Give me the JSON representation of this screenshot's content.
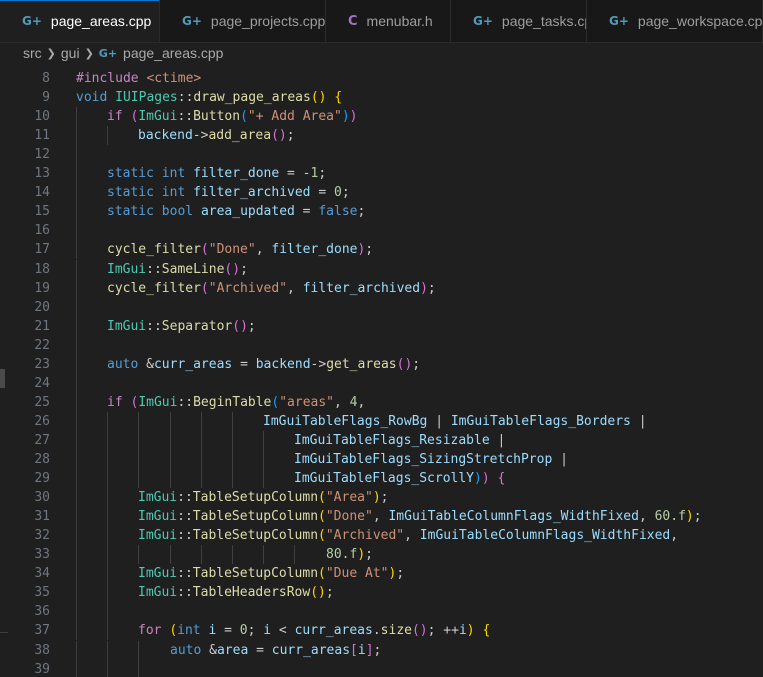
{
  "tabs": [
    {
      "label": "page_areas.cpp",
      "icon": "cpp-file-icon",
      "active": true
    },
    {
      "label": "page_projects.cpp",
      "icon": "cpp-file-icon",
      "active": false
    },
    {
      "label": "menubar.h",
      "icon": "c-header-file-icon",
      "active": false
    },
    {
      "label": "page_tasks.cpp",
      "icon": "cpp-file-icon",
      "active": false
    },
    {
      "label": "page_workspace.cpp",
      "icon": "cpp-file-icon",
      "active": false
    }
  ],
  "breadcrumb": [
    "src",
    "gui",
    "page_areas.cpp"
  ],
  "lines": [
    {
      "n": "8",
      "indent": 0,
      "t": [
        [
          "ctl",
          "#include "
        ],
        [
          "str",
          "<ctime>"
        ]
      ]
    },
    {
      "n": "9",
      "indent": 0,
      "t": [
        [
          "kw",
          "void "
        ],
        [
          "ns",
          "IUIPages"
        ],
        [
          "",
          "::"
        ],
        [
          "fn",
          "draw_page_areas"
        ],
        [
          "p1",
          "()"
        ],
        [
          "",
          " "
        ],
        [
          "p1",
          "{"
        ]
      ]
    },
    {
      "n": "10",
      "indent": 1,
      "t": [
        [
          "ctl",
          "if "
        ],
        [
          "p2",
          "("
        ],
        [
          "ns",
          "ImGui"
        ],
        [
          "",
          "::"
        ],
        [
          "fn",
          "Button"
        ],
        [
          "p3",
          "("
        ],
        [
          "str",
          "\"+ Add Area\""
        ],
        [
          "p3",
          ")"
        ],
        [
          "p2",
          ")"
        ]
      ]
    },
    {
      "n": "11",
      "indent": 2,
      "t": [
        [
          "var",
          "backend"
        ],
        [
          "",
          "->"
        ],
        [
          "fn",
          "add_area"
        ],
        [
          "p2",
          "()"
        ],
        [
          "",
          ";"
        ]
      ]
    },
    {
      "n": "12",
      "indent": 1,
      "t": []
    },
    {
      "n": "13",
      "indent": 1,
      "t": [
        [
          "kw",
          "static "
        ],
        [
          "kw",
          "int "
        ],
        [
          "var",
          "filter_done"
        ],
        [
          "",
          " = -"
        ],
        [
          "num",
          "1"
        ],
        [
          "",
          ";"
        ]
      ]
    },
    {
      "n": "14",
      "indent": 1,
      "t": [
        [
          "kw",
          "static "
        ],
        [
          "kw",
          "int "
        ],
        [
          "var",
          "filter_archived"
        ],
        [
          "",
          " = "
        ],
        [
          "num",
          "0"
        ],
        [
          "",
          ";"
        ]
      ]
    },
    {
      "n": "15",
      "indent": 1,
      "t": [
        [
          "kw",
          "static "
        ],
        [
          "kw",
          "bool "
        ],
        [
          "var",
          "area_updated"
        ],
        [
          "",
          " = "
        ],
        [
          "kw",
          "false"
        ],
        [
          "",
          ";"
        ]
      ]
    },
    {
      "n": "16",
      "indent": 1,
      "t": []
    },
    {
      "n": "17",
      "indent": 1,
      "t": [
        [
          "fn",
          "cycle_filter"
        ],
        [
          "p2",
          "("
        ],
        [
          "str",
          "\"Done\""
        ],
        [
          "",
          ", "
        ],
        [
          "var",
          "filter_done"
        ],
        [
          "p2",
          ")"
        ],
        [
          "",
          ";"
        ]
      ]
    },
    {
      "n": "18",
      "indent": 1,
      "t": [
        [
          "ns",
          "ImGui"
        ],
        [
          "",
          "::"
        ],
        [
          "fn",
          "SameLine"
        ],
        [
          "p2",
          "()"
        ],
        [
          "",
          ";"
        ]
      ]
    },
    {
      "n": "19",
      "indent": 1,
      "t": [
        [
          "fn",
          "cycle_filter"
        ],
        [
          "p2",
          "("
        ],
        [
          "str",
          "\"Archived\""
        ],
        [
          "",
          ", "
        ],
        [
          "var",
          "filter_archived"
        ],
        [
          "p2",
          ")"
        ],
        [
          "",
          ";"
        ]
      ]
    },
    {
      "n": "20",
      "indent": 1,
      "t": []
    },
    {
      "n": "21",
      "indent": 1,
      "t": [
        [
          "ns",
          "ImGui"
        ],
        [
          "",
          "::"
        ],
        [
          "fn",
          "Separator"
        ],
        [
          "p2",
          "()"
        ],
        [
          "",
          ";"
        ]
      ]
    },
    {
      "n": "22",
      "indent": 1,
      "t": []
    },
    {
      "n": "23",
      "indent": 1,
      "t": [
        [
          "kw",
          "auto "
        ],
        [
          "",
          "&"
        ],
        [
          "var",
          "curr_areas"
        ],
        [
          "",
          " = "
        ],
        [
          "var",
          "backend"
        ],
        [
          "",
          "->"
        ],
        [
          "fn",
          "get_areas"
        ],
        [
          "p2",
          "()"
        ],
        [
          "",
          ";"
        ]
      ]
    },
    {
      "n": "24",
      "indent": 1,
      "t": []
    },
    {
      "n": "25",
      "indent": 1,
      "t": [
        [
          "ctl",
          "if "
        ],
        [
          "p2",
          "("
        ],
        [
          "ns",
          "ImGui"
        ],
        [
          "",
          "::"
        ],
        [
          "fn",
          "BeginTable"
        ],
        [
          "p3",
          "("
        ],
        [
          "str",
          "\"areas\""
        ],
        [
          "",
          ", "
        ],
        [
          "num",
          "4"
        ],
        [
          "",
          ","
        ]
      ]
    },
    {
      "n": "26",
      "indent": 6,
      "t": [
        [
          "var",
          "ImGuiTableFlags_RowBg"
        ],
        [
          "",
          " | "
        ],
        [
          "var",
          "ImGuiTableFlags_Borders"
        ],
        [
          "",
          " |"
        ]
      ]
    },
    {
      "n": "27",
      "indent": 7,
      "t": [
        [
          "var",
          "ImGuiTableFlags_Resizable"
        ],
        [
          "",
          " |"
        ]
      ]
    },
    {
      "n": "28",
      "indent": 7,
      "t": [
        [
          "var",
          "ImGuiTableFlags_SizingStretchProp"
        ],
        [
          "",
          " |"
        ]
      ]
    },
    {
      "n": "29",
      "indent": 7,
      "t": [
        [
          "var",
          "ImGuiTableFlags_ScrollY"
        ],
        [
          "p3",
          ")"
        ],
        [
          "p2",
          ")"
        ],
        [
          "",
          " "
        ],
        [
          "p2",
          "{"
        ]
      ]
    },
    {
      "n": "30",
      "indent": 2,
      "t": [
        [
          "ns",
          "ImGui"
        ],
        [
          "",
          "::"
        ],
        [
          "fn",
          "TableSetupColumn"
        ],
        [
          "p1",
          "("
        ],
        [
          "str",
          "\"Area\""
        ],
        [
          "p1",
          ")"
        ],
        [
          "",
          ";"
        ]
      ]
    },
    {
      "n": "31",
      "indent": 2,
      "t": [
        [
          "ns",
          "ImGui"
        ],
        [
          "",
          "::"
        ],
        [
          "fn",
          "TableSetupColumn"
        ],
        [
          "p1",
          "("
        ],
        [
          "str",
          "\"Done\""
        ],
        [
          "",
          ", "
        ],
        [
          "var",
          "ImGuiTableColumnFlags_WidthFixed"
        ],
        [
          "",
          ", "
        ],
        [
          "num",
          "60.f"
        ],
        [
          "p1",
          ")"
        ],
        [
          "",
          ";"
        ]
      ]
    },
    {
      "n": "32",
      "indent": 2,
      "t": [
        [
          "ns",
          "ImGui"
        ],
        [
          "",
          "::"
        ],
        [
          "fn",
          "TableSetupColumn"
        ],
        [
          "p1",
          "("
        ],
        [
          "str",
          "\"Archived\""
        ],
        [
          "",
          ", "
        ],
        [
          "var",
          "ImGuiTableColumnFlags_WidthFixed"
        ],
        [
          "",
          ","
        ]
      ]
    },
    {
      "n": "33",
      "indent": 8,
      "t": [
        [
          "num",
          "80.f"
        ],
        [
          "p1",
          ")"
        ],
        [
          "",
          ";"
        ]
      ]
    },
    {
      "n": "34",
      "indent": 2,
      "t": [
        [
          "ns",
          "ImGui"
        ],
        [
          "",
          "::"
        ],
        [
          "fn",
          "TableSetupColumn"
        ],
        [
          "p1",
          "("
        ],
        [
          "str",
          "\"Due At\""
        ],
        [
          "p1",
          ")"
        ],
        [
          "",
          ";"
        ]
      ]
    },
    {
      "n": "35",
      "indent": 2,
      "t": [
        [
          "ns",
          "ImGui"
        ],
        [
          "",
          "::"
        ],
        [
          "fn",
          "TableHeadersRow"
        ],
        [
          "p1",
          "()"
        ],
        [
          "",
          ";"
        ]
      ]
    },
    {
      "n": "36",
      "indent": 2,
      "t": []
    },
    {
      "n": "37",
      "indent": 2,
      "t": [
        [
          "ctl",
          "for "
        ],
        [
          "p1",
          "("
        ],
        [
          "kw",
          "int "
        ],
        [
          "var",
          "i"
        ],
        [
          "",
          " = "
        ],
        [
          "num",
          "0"
        ],
        [
          "",
          "; "
        ],
        [
          "var",
          "i"
        ],
        [
          "",
          " < "
        ],
        [
          "var",
          "curr_areas"
        ],
        [
          "",
          "."
        ],
        [
          "fn",
          "size"
        ],
        [
          "p2",
          "()"
        ],
        [
          "",
          "; ++"
        ],
        [
          "var",
          "i"
        ],
        [
          "p1",
          ")"
        ],
        [
          "",
          " "
        ],
        [
          "p1",
          "{"
        ]
      ]
    },
    {
      "n": "38",
      "indent": 3,
      "t": [
        [
          "kw",
          "auto "
        ],
        [
          "",
          "&"
        ],
        [
          "var",
          "area"
        ],
        [
          "",
          " = "
        ],
        [
          "var",
          "curr_areas"
        ],
        [
          "p2",
          "["
        ],
        [
          "var",
          "i"
        ],
        [
          "p2",
          "]"
        ],
        [
          "",
          ";"
        ]
      ]
    },
    {
      "n": "39",
      "indent": 3,
      "t": []
    }
  ]
}
